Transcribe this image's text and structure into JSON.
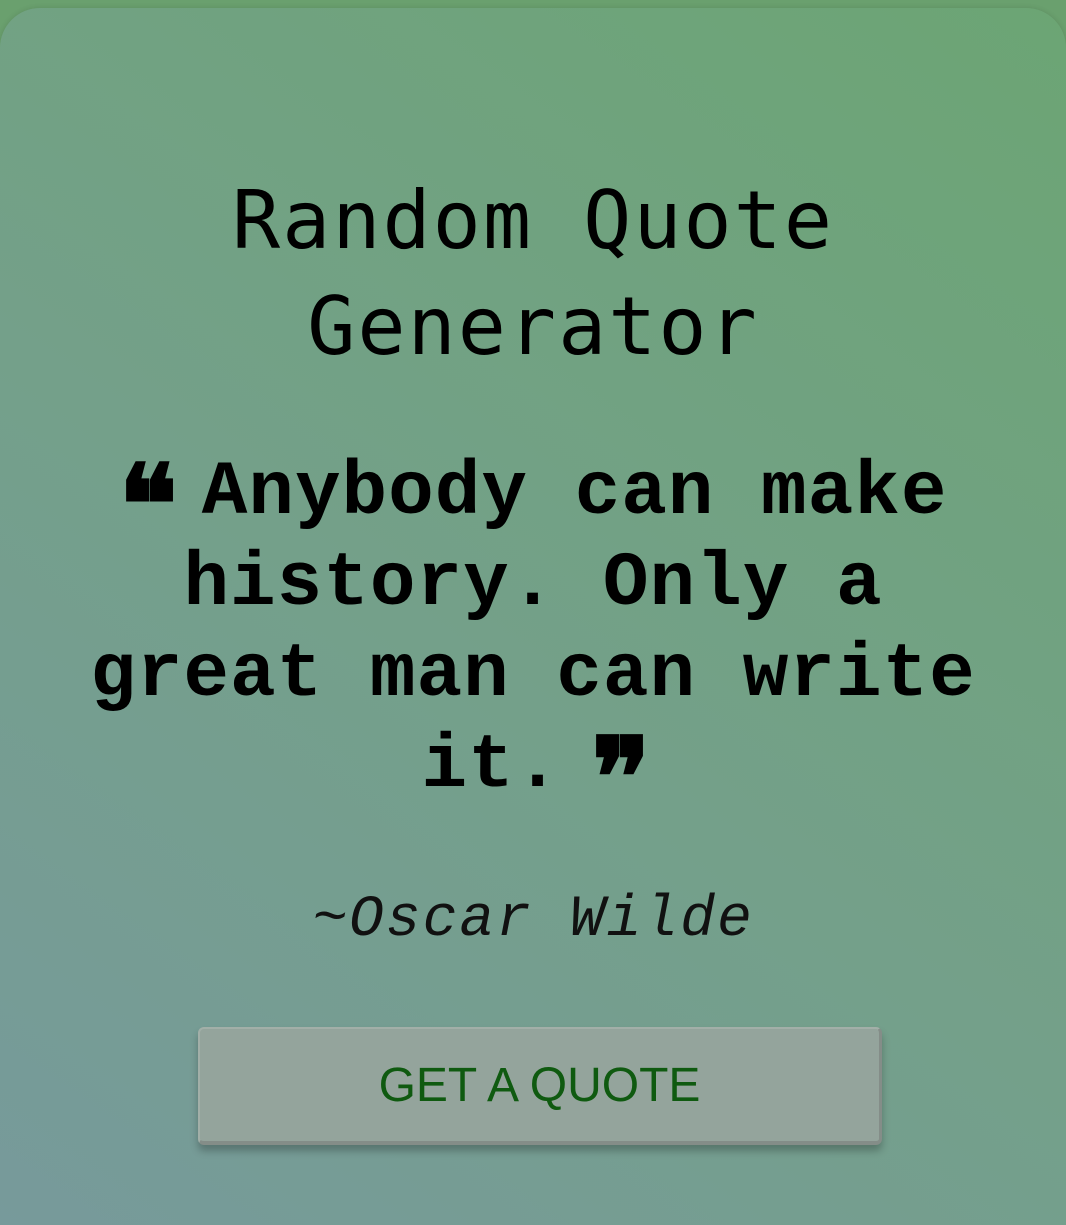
{
  "app": {
    "title": "Random Quote Generator"
  },
  "quote": {
    "open_mark_icon": "quote-open-icon",
    "open_mark": "❝",
    "text": "Anybody can make history. Only a great man can write it.",
    "close_mark_icon": "quote-close-icon",
    "close_mark": "❞",
    "author": "~Oscar Wilde"
  },
  "actions": {
    "get_quote_label": "GET A QUOTE"
  },
  "colors": {
    "gradient_start": "#779a9b",
    "gradient_end": "#6ca574",
    "button_bg": "#94a49c",
    "button_text": "#0f5a10",
    "text": "#000000"
  }
}
